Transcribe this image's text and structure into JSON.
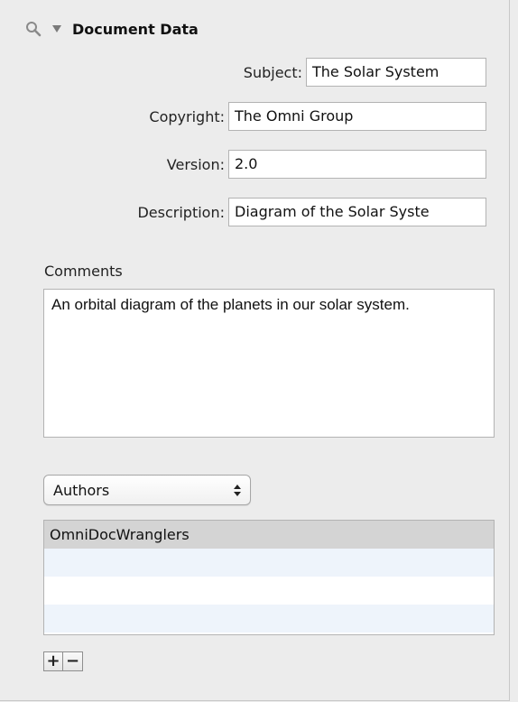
{
  "header": {
    "icon": "search-icon",
    "disclosure_icon": "disclosure-triangle-icon",
    "title": "Document Data"
  },
  "fields": {
    "subject": {
      "label": "Subject:",
      "value": "The Solar System"
    },
    "copyright": {
      "label": "Copyright:",
      "value": "The Omni Group"
    },
    "version": {
      "label": "Version:",
      "value": "2.0"
    },
    "description": {
      "label": "Description:",
      "value": "Diagram of the Solar Syste"
    }
  },
  "comments": {
    "label": "Comments",
    "value": "An orbital diagram of the planets in our solar system."
  },
  "popup": {
    "selected": "Authors",
    "icon": "up-down-arrows-icon"
  },
  "authors_list": {
    "rows": [
      "OmniDocWranglers",
      "",
      "",
      ""
    ]
  },
  "buttons": {
    "add": "+",
    "remove": "−"
  },
  "colors": {
    "background": "#ececec",
    "selected_row": "#d4d4d4",
    "alternate_row": "#eef4fb"
  }
}
